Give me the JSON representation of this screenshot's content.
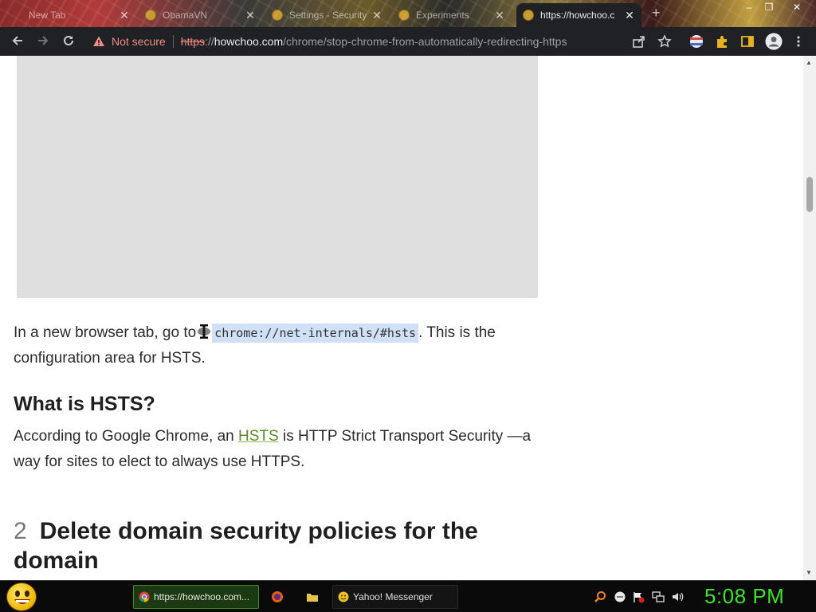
{
  "browser": {
    "tabs": [
      {
        "label": "New Tab",
        "active": false
      },
      {
        "label": "ObamaVN",
        "active": false
      },
      {
        "label": "Settings - Security",
        "active": false
      },
      {
        "label": "Experiments",
        "active": false
      },
      {
        "label": "https://howchoo.c",
        "active": true
      }
    ],
    "new_tab": "+",
    "window_controls": {
      "minimize": "–",
      "restore": "❐",
      "close": "✕"
    },
    "security_label": "Not secure",
    "url_scheme": "https",
    "url_separator": "://",
    "url_host": "howchoo.com",
    "url_path": "/chrome/stop-chrome-from-automatically-redirecting-https"
  },
  "article": {
    "p1_before": "In a new browser tab, go to",
    "p1_code": "chrome://net-internals/#hsts",
    "p1_after": ". This is the configuration area for HSTS.",
    "h_what": "What is HSTS?",
    "p2_before": "According to Google Chrome, an ",
    "p2_link": "HSTS",
    "p2_after": " is HTTP Strict Transport Security —a way for sites to elect to always use HTTPS.",
    "step_number": "2",
    "step_title": "Delete domain security policies for the domain"
  },
  "taskbar": {
    "chrome_task": "https://howchoo.com...",
    "messenger_task": "Yahoo! Messenger",
    "clock": "5:08 PM"
  },
  "colors": {
    "accent_link": "#5a8a2a",
    "not_secure": "#f28b82",
    "clock": "#40e030"
  },
  "icons": [
    "back-icon",
    "forward-icon",
    "reload-icon",
    "warning-icon",
    "share-icon",
    "star-icon",
    "profile-avatar",
    "puzzle-icon",
    "sidepanel-icon",
    "menu-icon",
    "smiley-start-icon",
    "chrome-icon",
    "firefox-icon",
    "folder-icon",
    "yahoo-smiley-icon",
    "search-icon",
    "speaker-icon"
  ]
}
